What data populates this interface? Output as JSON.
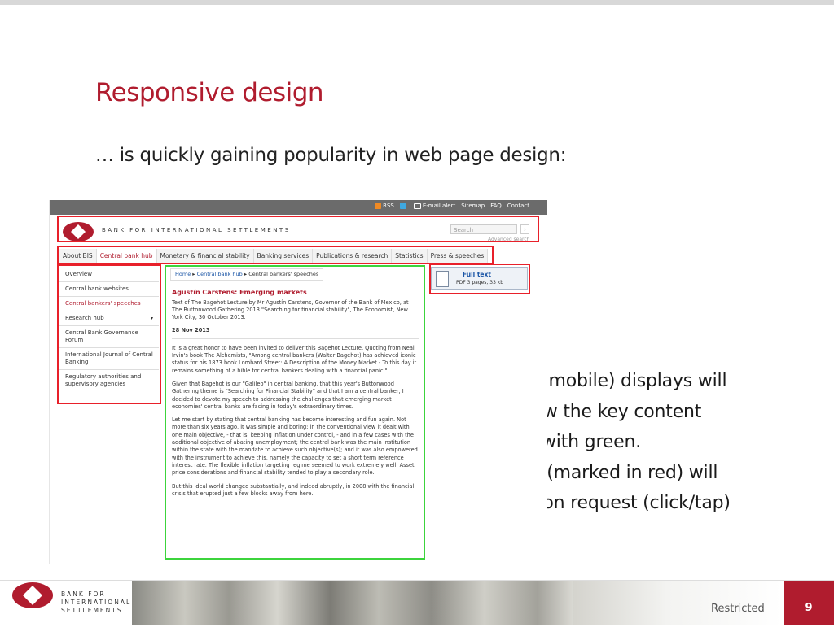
{
  "slide": {
    "title": "Responsive design",
    "subtitle": "… is quickly gaining popularity in web page design:",
    "side_lines": [
      "Smaller (mobile) displays will",
      "only show the key content",
      "marked with green.",
      "The rest (marked in red) will",
      "show upon request (click/tap)"
    ]
  },
  "site": {
    "top_links": [
      "RSS",
      "E-mail alert",
      "Sitemap",
      "FAQ",
      "Contact"
    ],
    "org_name": "BANK FOR INTERNATIONAL SETTLEMENTS",
    "search_placeholder": "Search",
    "advanced_search": "Advanced search",
    "search_arrow": "›",
    "nav": [
      "About BIS",
      "Central bank hub",
      "Monetary & financial stability",
      "Banking services",
      "Publications & research",
      "Statistics",
      "Press & speeches"
    ],
    "left_nav": [
      "Overview",
      "Central bank websites",
      "Central bankers' speeches",
      "Research hub",
      "Central Bank Governance Forum",
      "International Journal of Central Banking",
      "Regulatory authorities and supervisory agencies"
    ],
    "breadcrumb": {
      "home": "Home",
      "hub": "Central bank hub",
      "current": "Central bankers' speeches",
      "separator": "▸"
    },
    "article": {
      "title": "Agustín Carstens: Emerging markets",
      "intro": "Text of The Bagehot Lecture by Mr Agustín Carstens, Governor of the Bank of Mexico, at The Buttonwood Gathering 2013 \"Searching for financial stability\", The Economist, New York City, 30 October 2013.",
      "date": "28 Nov 2013",
      "paragraphs": [
        "It is a great honor to have been invited to deliver this Bagehot Lecture. Quoting from Neal Irvin's book The Alchemists, \"Among central bankers (Walter Bagehot) has achieved iconic status for his 1873 book Lombard Street: A Description of the Money Market - To this day it remains something of a bible for central bankers dealing with a financial panic.\"",
        "Given that Bagehot is our \"Galileo\" in central banking, that this year's Buttonwood Gathering theme is \"Searching for Financial Stability\" and that I am a central banker, I decided to devote my speech to addressing the challenges that emerging market economies' central banks are facing in today's extraordinary times.",
        "Let me start by stating that central banking has become interesting and fun again. Not more than six years ago, it was simple and boring: in the conventional view it dealt with one main objective, - that is, keeping inflation under control, - and in a few cases with the additional objective of abating unemployment; the central bank was the main institution within the state with the mandate to achieve such objective(s); and it was also empowered with the instrument to achieve this, namely the capacity to set a short term reference interest rate. The flexible inflation targeting regime seemed to work extremely well. Asset price considerations and financial stability tended to play a secondary role.",
        "But this ideal world changed substantially, and indeed abruptly, in 2008 with the financial crisis that erupted just a few blocks away from here."
      ]
    },
    "full_text": {
      "label": "Full text",
      "meta": "PDF 3 pages, 33 kb"
    }
  },
  "footer": {
    "org_lines": [
      "BANK FOR",
      "INTERNATIONAL",
      "SETTLEMENTS"
    ],
    "classification": "Restricted",
    "page_number": "9"
  },
  "colors": {
    "accent_red": "#b01c2e",
    "highlight_red": "#e8202a",
    "highlight_green": "#3cd43c"
  }
}
